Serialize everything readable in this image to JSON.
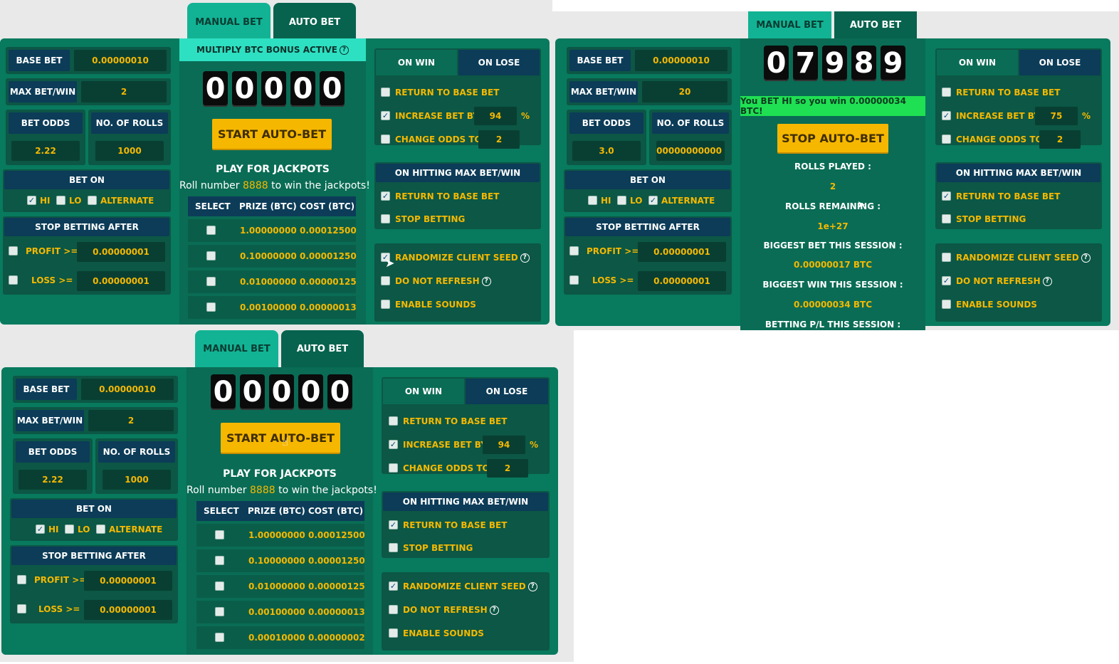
{
  "tabs": {
    "manual": "MANUAL BET",
    "auto": "AUTO BET"
  },
  "common": {
    "base_bet": "BASE BET",
    "max_bet_win": "MAX BET/WIN",
    "bet_odds": "BET ODDS",
    "no_of_rolls": "NO. OF ROLLS",
    "bet_on": "BET ON",
    "hi": "HI",
    "lo": "LO",
    "alternate": "ALTERNATE",
    "stop_betting_after": "STOP BETTING AFTER",
    "profit": "PROFIT >=",
    "loss": "LOSS >=",
    "on_win": "ON WIN",
    "on_lose": "ON LOSE",
    "return_to_base": "RETURN TO BASE BET",
    "increase_by": "INCREASE BET BY",
    "percent": "%",
    "change_odds": "CHANGE ODDS TO",
    "on_hitting_max": "ON HITTING MAX BET/WIN",
    "stop_betting": "STOP BETTING",
    "randomize": "RANDOMIZE CLIENT SEED",
    "do_not_refresh": "DO NOT REFRESH",
    "enable_sounds": "ENABLE SOUNDS",
    "qmark": "?",
    "play_jackpots": "PLAY FOR JACKPOTS",
    "roll_pre": "Roll number",
    "roll_num": "8888",
    "roll_post": "to win the jackpots!",
    "th_select": "SELECT",
    "th_prize": "PRIZE (BTC)",
    "th_cost": "COST (BTC)"
  },
  "jackpots": [
    {
      "prize": "1.00000000",
      "cost": "0.00012500"
    },
    {
      "prize": "0.10000000",
      "cost": "0.00001250"
    },
    {
      "prize": "0.01000000",
      "cost": "0.00000125"
    },
    {
      "prize": "0.00100000",
      "cost": "0.00000013"
    },
    {
      "prize": "0.00010000",
      "cost": "0.00000002"
    }
  ],
  "p1": {
    "bonus": "MULTIPLY BTC BONUS ACTIVE",
    "base_bet": "0.00000010",
    "max_bet": "2",
    "odds": "2.22",
    "rolls": "1000",
    "profit": "0.00000001",
    "loss": "0.00000001",
    "digits": [
      "0",
      "0",
      "0",
      "0",
      "0"
    ],
    "button": "START AUTO-BET",
    "increase": "94",
    "change_odds": "2"
  },
  "p2": {
    "base_bet": "0.00000010",
    "max_bet": "20",
    "odds": "3.0",
    "rolls": "!00000000000",
    "profit": "0.00000001",
    "loss": "0.00000001",
    "digits": [
      "0",
      "7",
      "9",
      "8",
      "9"
    ],
    "result": "You BET HI so you win 0.00000034 BTC!",
    "button": "STOP AUTO-BET",
    "rolls_played_label": "ROLLS PLAYED :",
    "rolls_played": "2",
    "rolls_remaining_label": "ROLLS REMAINING :",
    "rolls_remaining": "1e+27",
    "biggest_bet_label": "BIGGEST BET THIS SESSION :",
    "biggest_bet": "0.00000017 BTC",
    "biggest_win_label": "BIGGEST WIN THIS SESSION :",
    "biggest_win": "0.00000034 BTC",
    "pl_label": "BETTING P/L THIS SESSION :",
    "increase": "75",
    "change_odds": "2"
  },
  "p3": {
    "base_bet": "0.00000010",
    "max_bet": "2",
    "odds": "2.22",
    "rolls": "1000",
    "profit": "0.00000001",
    "loss": "0.00000001",
    "digits": [
      "0",
      "0",
      "0",
      "0",
      "0"
    ],
    "button": "START AUTO-BET",
    "increase": "94",
    "change_odds": "2"
  },
  "colors": {
    "panel": "#087a5e",
    "header": "#0c3c58",
    "accent": "#f5b800",
    "tab_active": "#12b394"
  }
}
